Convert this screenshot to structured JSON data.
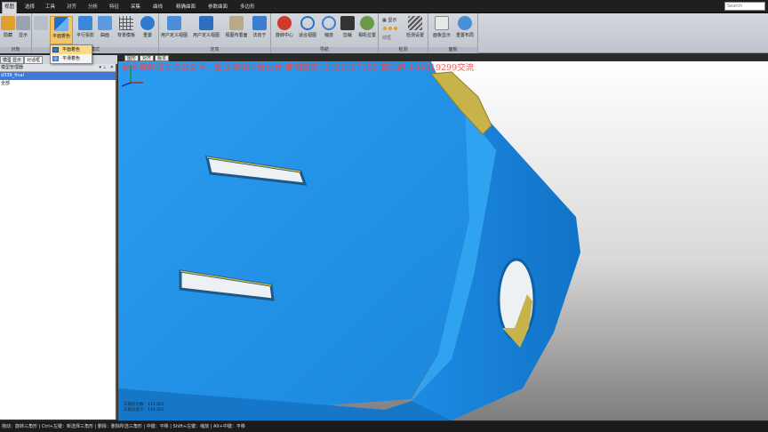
{
  "menu": {
    "tabs": [
      "视图",
      "选择",
      "工具",
      "对齐",
      "分析",
      "特征",
      "采集",
      "曲线",
      "精确曲面",
      "参数曲面",
      "多边形"
    ],
    "active_index": 0,
    "search_placeholder": "Search"
  },
  "ribbon": {
    "groups": [
      {
        "label": "对象",
        "buttons": [
          "隐藏",
          "显示"
        ]
      },
      {
        "label": "模式",
        "buttons": [
          "平面着色",
          "平行投影",
          "曲面",
          "背景模板",
          "重置"
        ]
      },
      {
        "label": "定向",
        "buttons": [
          "用户定义视图",
          "用户定义视图",
          "视图布置面",
          "法向于"
        ]
      },
      {
        "label": "导航",
        "buttons": [
          "旋转中心",
          "适合视图",
          "缩放",
          "剪裁",
          "相机位置"
        ]
      },
      {
        "label": "检测",
        "buttons": [
          "显示",
          "显示",
          "线框"
        ]
      },
      {
        "label": "视图",
        "buttons": [
          "面板显示",
          "重置布局"
        ]
      }
    ],
    "extra_group_label": "检测设置",
    "right_group_label": "面板"
  },
  "dropdown": {
    "items": [
      "平面着色",
      "平滑着色"
    ],
    "highlighted": 0
  },
  "left_panel": {
    "tabs": [
      "模型",
      "显示",
      "对话框"
    ],
    "active_tab": 2,
    "header": "模型管理器",
    "rows": [
      "d339_final",
      "全部"
    ]
  },
  "viewport": {
    "tabs": [
      "图形",
      "对齐",
      "版本"
    ],
    "watermark": "更多视频请关注公众号：阳江瀚阳抄数设计 或加微信13189167159 或扫群:185619299交流",
    "stats": [
      "三角形计数：114,503",
      "三角形总计：114,503"
    ],
    "colors": {
      "mesh": "#1e8fe0",
      "mesh_dark": "#0d5fa8",
      "hole_edge": "#c8b24a",
      "watermark": "#ff3f3f"
    }
  },
  "statusbar": {
    "text": "拖动：旋转三角形 | Ctrl+左键：新选择三角形 | 删除：删除所选三角形 | 中键：平移 | Shift+左键：缩放 | Alt+中键：平移"
  }
}
